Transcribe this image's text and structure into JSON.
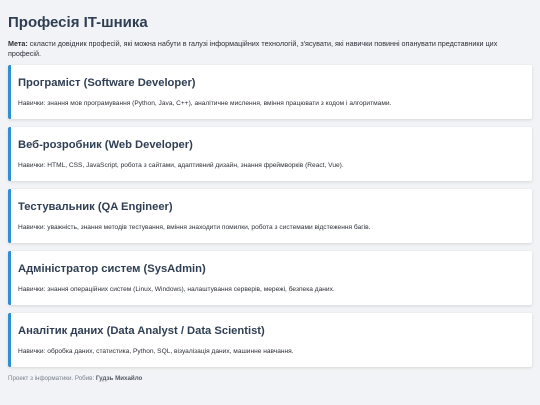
{
  "page": {
    "title": "Професія IT-шника",
    "goal_label": "Мета:",
    "goal_text": " скласти довідник професій, які можна набути в галузі інформаційних технологій, з'ясувати, які навички повинні опанувати представники цих професій."
  },
  "professions": [
    {
      "title": "Програміст (Software Developer)",
      "skills": "Навички: знання мов програмування (Python, Java, C++), аналітичне мислення, вміння працювати з кодом і алгоритмами."
    },
    {
      "title": "Веб-розробник (Web Developer)",
      "skills": "Навички: HTML, CSS, JavaScript, робота з сайтами, адаптивний дизайн, знання фреймворків (React, Vue)."
    },
    {
      "title": "Тестувальник (QA Engineer)",
      "skills": "Навички: уважність, знання методів тестування, вміння знаходити помилки, робота з системами відстеження багів."
    },
    {
      "title": "Адміністратор систем (SysAdmin)",
      "skills": "Навички: знання операційних систем (Linux, Windows), налаштування серверів, мережі, безпека даних."
    },
    {
      "title": "Аналітик даних (Data Analyst / Data Scientist)",
      "skills": "Навички: обробка даних, статистика, Python, SQL, візуалізація даних, машинне навчання."
    }
  ],
  "footer": {
    "text": "Проект з інформатики. Робив: ",
    "author": "Гудзь Михайло"
  },
  "colors": {
    "accent": "#2e8fd2",
    "heading": "#2f3e52",
    "background": "#f1f3f6"
  }
}
